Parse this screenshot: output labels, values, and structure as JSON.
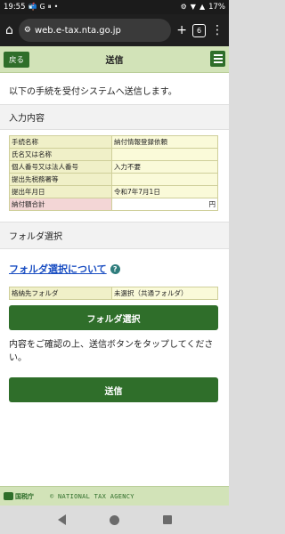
{
  "status": {
    "time": "19:55",
    "battery": "17%",
    "left_icons": [
      "📬",
      "G",
      "⏸",
      "•"
    ],
    "right_icons": [
      "⚙",
      "▼",
      "▲"
    ]
  },
  "browser": {
    "url": "web.e-tax.nta.go.jp",
    "tab_count": "6"
  },
  "header": {
    "back_label": "戻る",
    "title": "送信"
  },
  "intro": "以下の手続を受付システムへ送信します。",
  "input_section": {
    "title": "入力内容",
    "rows": [
      {
        "label": "手続名称",
        "value": "納付情報登録依頼"
      },
      {
        "label": "氏名又は名称",
        "value": ""
      },
      {
        "label": "個人番号又は法人番号",
        "value": "入力不要"
      },
      {
        "label": "提出先税務署等",
        "value": ""
      },
      {
        "label": "提出年月日",
        "value": "令和7年7月1日"
      }
    ],
    "total_label": "納付額合計",
    "total_value": "円"
  },
  "folder_section": {
    "title": "フォルダ選択",
    "link": "フォルダ選択について",
    "help": "?",
    "row_label": "格納先フォルダ",
    "row_value": "未選択（共通フォルダ）",
    "button": "フォルダ選択"
  },
  "confirm_text": "内容をご確認の上、送信ボタンをタップしてください。",
  "send_button": "送信",
  "footer": {
    "logo": "国税庁",
    "copyright": "© NATIONAL TAX AGENCY"
  }
}
